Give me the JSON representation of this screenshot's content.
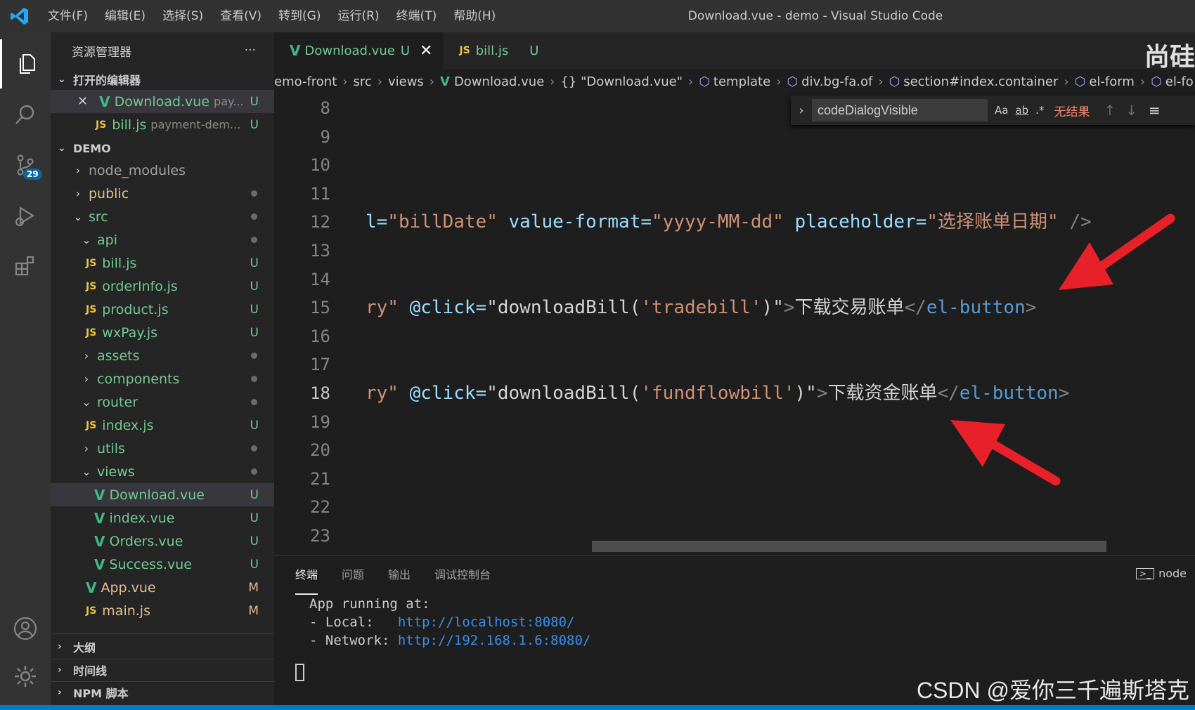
{
  "titlebar": {
    "menus": [
      "文件(F)",
      "编辑(E)",
      "选择(S)",
      "查看(V)",
      "转到(G)",
      "运行(R)",
      "终端(T)",
      "帮助(H)"
    ],
    "title": "Download.vue - demo - Visual Studio Code"
  },
  "activity": {
    "scm_badge": "29",
    "icons": [
      "files-icon",
      "search-icon",
      "source-control-icon",
      "run-debug-icon",
      "extensions-icon",
      "account-icon",
      "settings-gear-icon"
    ]
  },
  "sidebar": {
    "title": "资源管理器",
    "more": "···",
    "open_editors": {
      "label": "打开的编辑器",
      "items": [
        {
          "name": "Download.vue",
          "path": "pay...",
          "status": "U"
        },
        {
          "name": "bill.js",
          "path": "payment-dem...",
          "status": "U"
        }
      ]
    },
    "project": {
      "label": "DEMO",
      "tree": [
        {
          "name": "node_modules"
        },
        {
          "name": "public"
        },
        {
          "name": "src"
        },
        {
          "name": "api"
        },
        {
          "name": "bill.js",
          "status": "U"
        },
        {
          "name": "orderInfo.js",
          "status": "U"
        },
        {
          "name": "product.js",
          "status": "U"
        },
        {
          "name": "wxPay.js",
          "status": "U"
        },
        {
          "name": "assets"
        },
        {
          "name": "components"
        },
        {
          "name": "router"
        },
        {
          "name": "index.js",
          "status": "U"
        },
        {
          "name": "utils"
        },
        {
          "name": "views"
        },
        {
          "name": "Download.vue",
          "status": "U"
        },
        {
          "name": "index.vue",
          "status": "U"
        },
        {
          "name": "Orders.vue",
          "status": "U"
        },
        {
          "name": "Success.vue",
          "status": "U"
        },
        {
          "name": "App.vue",
          "status": "M"
        },
        {
          "name": "main.js",
          "status": "M"
        }
      ]
    },
    "bottom_sections": [
      "大纲",
      "时间线",
      "NPM 脚本"
    ]
  },
  "tabs": [
    {
      "name": "Download.vue",
      "status": "U",
      "close": "✕"
    },
    {
      "name": "bill.js",
      "status": "U"
    }
  ],
  "brand_text": "尚硅",
  "breadcrumb": [
    "emo-front",
    "src",
    "views",
    "Download.vue",
    "{} \"Download.vue\"",
    "template",
    "div.bg-fa.of",
    "section#index.container",
    "el-form",
    "el-fo"
  ],
  "find": {
    "value": "codeDialogVisible",
    "opt_case": "Aa",
    "opt_word": "ab",
    "opt_regex": ".*",
    "result": "无结果"
  },
  "editor": {
    "line_numbers": [
      "8",
      "9",
      "10",
      "11",
      "12",
      "13",
      "14",
      "15",
      "16",
      "17",
      "18",
      "19",
      "20",
      "21",
      "22",
      "23"
    ],
    "current_line": "18",
    "line12": {
      "a": "l=",
      "b": "\"billDate\"",
      "c": " value-format=",
      "d": "\"yyyy-MM-dd\"",
      "e": " placeholder=",
      "f": "\"选择账单日期\"",
      "g": " />"
    },
    "line15": {
      "a": "ry\"",
      "b": " @click=",
      "c": "\"downloadBill(",
      "d": "'tradebill'",
      "e": ")\"",
      "f": ">",
      "g": "下载交易账单",
      "h": "</",
      "i": "el-button",
      "j": ">"
    },
    "line18": {
      "a": "ry\"",
      "b": " @click=",
      "c": "\"downloadBill(",
      "d": "'fundflowbill'",
      "e": ")\"",
      "f": ">",
      "g": "下载资金账单",
      "h": "</",
      "i": "el-button",
      "j": ">"
    }
  },
  "panel": {
    "tabs": [
      "终端",
      "问题",
      "输出",
      "调试控制台"
    ],
    "node": "node",
    "terminal": {
      "l1": "App running at:",
      "l2_label": "- Local:   ",
      "l2_link": "http://localhost:8080/",
      "l3_label": "- Network: ",
      "l3_link": "http://192.168.1.6:8080/"
    }
  },
  "watermark": "CSDN @爱你三千遍斯塔克",
  "colors": {
    "accent": "#007acc",
    "arrow": "#e8202a",
    "untracked": "#73c991",
    "modified": "#e2c08d"
  }
}
